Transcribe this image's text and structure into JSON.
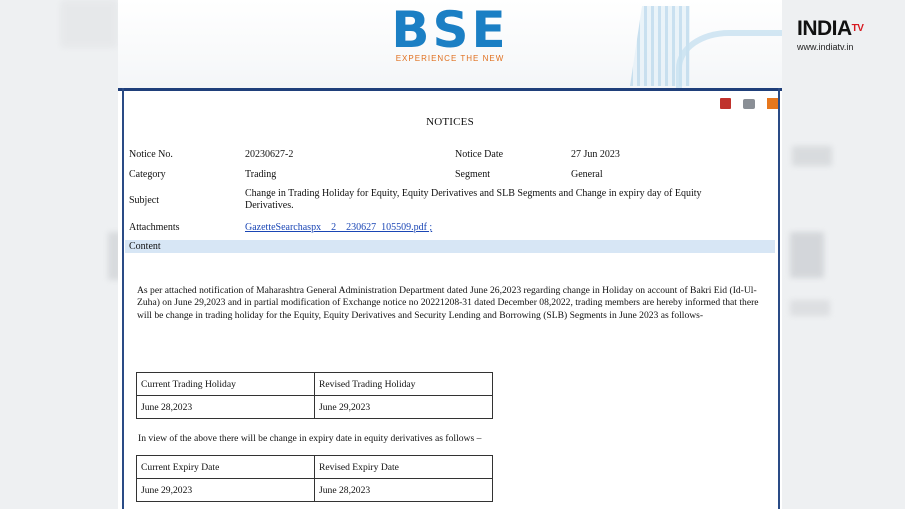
{
  "brand": {
    "name": "INDIA",
    "tv": "TV",
    "url": "www.indiatv.in"
  },
  "header": {
    "logo": "BSE",
    "tagline": "EXPERIENCE THE NEW"
  },
  "notice": {
    "title": "NOTICES",
    "notice_no_label": "Notice No.",
    "notice_no": "20230627-2",
    "notice_date_label": "Notice Date",
    "notice_date": "27 Jun 2023",
    "category_label": "Category",
    "category": "Trading",
    "segment_label": "Segment",
    "segment": "General",
    "subject_label": "Subject",
    "subject": "Change in Trading Holiday for Equity, Equity Derivatives and SLB Segments and Change in expiry day of Equity Derivatives.",
    "attachments_label": "Attachments",
    "attachment": "GazetteSearchaspx__2__230627_105509.pdf ;",
    "content_label": "Content",
    "paragraph": "As per attached notification of Maharashtra General Administration Department dated June 26,2023 regarding change in Holiday on account of Bakri Eid (Id-Ul-Zuha) on June 29,2023 and in partial modification of Exchange notice no 20221208-31 dated December 08,2022, trading members are hereby informed that there will be change in trading holiday for the Equity, Equity Derivatives and Security Lending and Borrowing (SLB) Segments in June 2023 as follows-",
    "holiday_table": {
      "headers": [
        "Current Trading Holiday",
        "Revised Trading Holiday"
      ],
      "row": [
        "June 28,2023",
        "June 29,2023"
      ]
    },
    "expiry_note": "In view of the above there will be change in expiry date in equity derivatives as follows –",
    "expiry_table": {
      "headers": [
        "Current Expiry Date",
        "Revised Expiry Date"
      ],
      "row": [
        "June 29,2023",
        "June 28,2023"
      ]
    }
  }
}
